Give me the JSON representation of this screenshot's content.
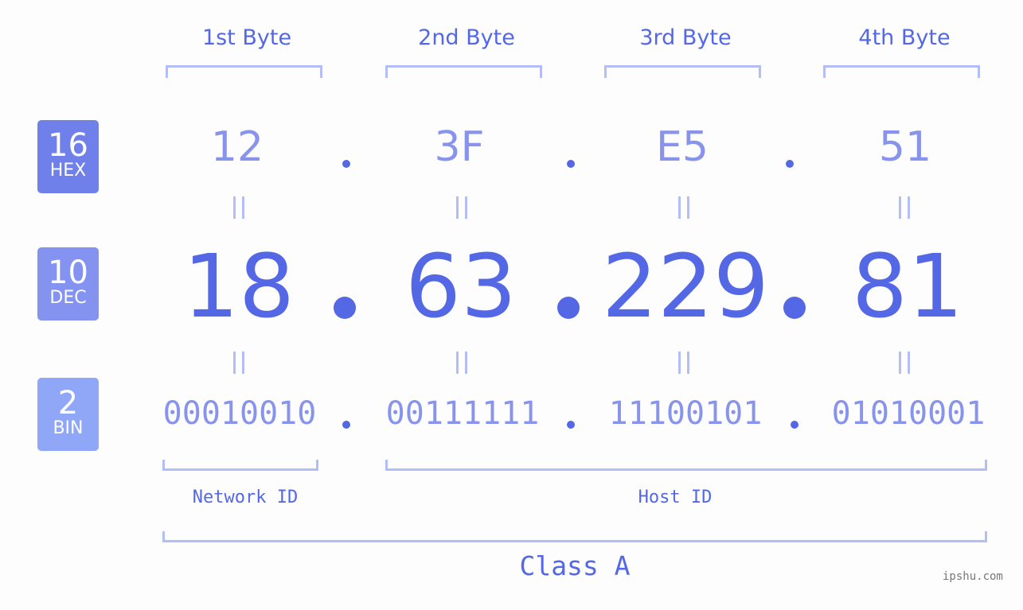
{
  "byte_headers": [
    "1st Byte",
    "2nd Byte",
    "3rd Byte",
    "4th Byte"
  ],
  "badges": [
    {
      "num": "16",
      "label": "HEX",
      "color": "#7080ea"
    },
    {
      "num": "10",
      "label": "DEC",
      "color": "#8493ef"
    },
    {
      "num": "2",
      "label": "BIN",
      "color": "#90a7f7"
    }
  ],
  "hex": [
    "12",
    "3F",
    "E5",
    "51"
  ],
  "dec": [
    "18",
    "63",
    "229",
    "81"
  ],
  "bin": [
    "00010010",
    "00111111",
    "11100101",
    "01010001"
  ],
  "network_label": "Network ID",
  "host_label": "Host ID",
  "class_label": "Class A",
  "watermark": "ipshu.com",
  "colors": {
    "accent": "#5468e6",
    "light": "#8893ec",
    "bracket": "#b3bdf7"
  }
}
